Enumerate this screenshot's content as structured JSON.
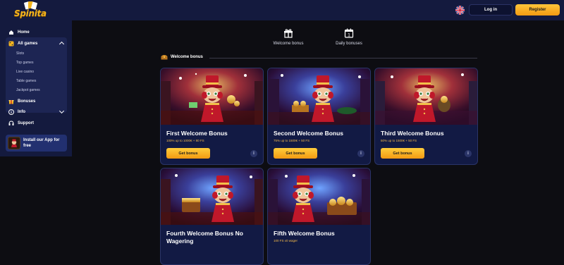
{
  "brand": {
    "name": "Spinita",
    "gold": "#f5b51e",
    "navy": "#141a3e"
  },
  "header": {
    "login_label": "Log in",
    "register_label": "Register",
    "language_icon": "uk-flag-icon"
  },
  "sidebar": {
    "home": "Home",
    "all_games": "All games",
    "sub_items": [
      "Slots",
      "Top games",
      "Live casino",
      "Table games",
      "Jackpot games"
    ],
    "bonuses": "Bonuses",
    "info": "Info",
    "support": "Support",
    "app_promo": "Install our App for free"
  },
  "tabs": [
    {
      "label": "Welcome bonus",
      "icon": "gift-box-icon"
    },
    {
      "label": "Daily bonuses",
      "icon": "calendar-icon"
    }
  ],
  "section": {
    "title": "Welcome bonus",
    "icon": "treasure-chest-icon"
  },
  "cards": [
    {
      "title": "First Welcome Bonus",
      "subtitle": "100% up to 1000€ + 80 FS",
      "button": "Get bonus"
    },
    {
      "title": "Second Welcome Bonus",
      "subtitle": "75% up to 1500€ + 50 FS",
      "button": "Get bonus"
    },
    {
      "title": "Third Welcome Bonus",
      "subtitle": "50% up to 1500€ + 50 FS",
      "button": "Get bonus"
    },
    {
      "title": "Fourth Welcome Bonus No Wagering",
      "subtitle": "",
      "button": ""
    },
    {
      "title": "Fifth Welcome Bonus",
      "subtitle": "100 FS x0 wager",
      "button": ""
    }
  ]
}
